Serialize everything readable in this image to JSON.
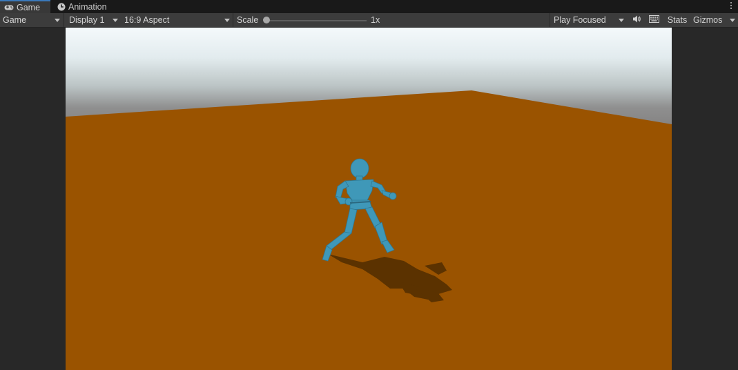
{
  "tabs": [
    {
      "label": "Game",
      "icon": "gamepad-icon",
      "active": true
    },
    {
      "label": "Animation",
      "icon": "clock-icon",
      "active": false
    }
  ],
  "toolbar": {
    "view_select": "Game",
    "display_select": "Display 1",
    "aspect_select": "16:9 Aspect",
    "scale_label": "Scale",
    "scale_value": "1x",
    "scale_slider_fraction": 0.0,
    "play_mode_select": "Play Focused",
    "stats_label": "Stats",
    "gizmos_label": "Gizmos"
  },
  "scene": {
    "sky_color_top": "#f4f9fb",
    "sky_color_horizon": "#8a8a8a",
    "ground_color": "#9a5300",
    "character_color": "#3f98b8"
  },
  "colors": {
    "panel_bg": "#282828",
    "toolbar_bg": "#3c3c3c",
    "tab_active": "#383838",
    "accent": "#3a79bb"
  }
}
